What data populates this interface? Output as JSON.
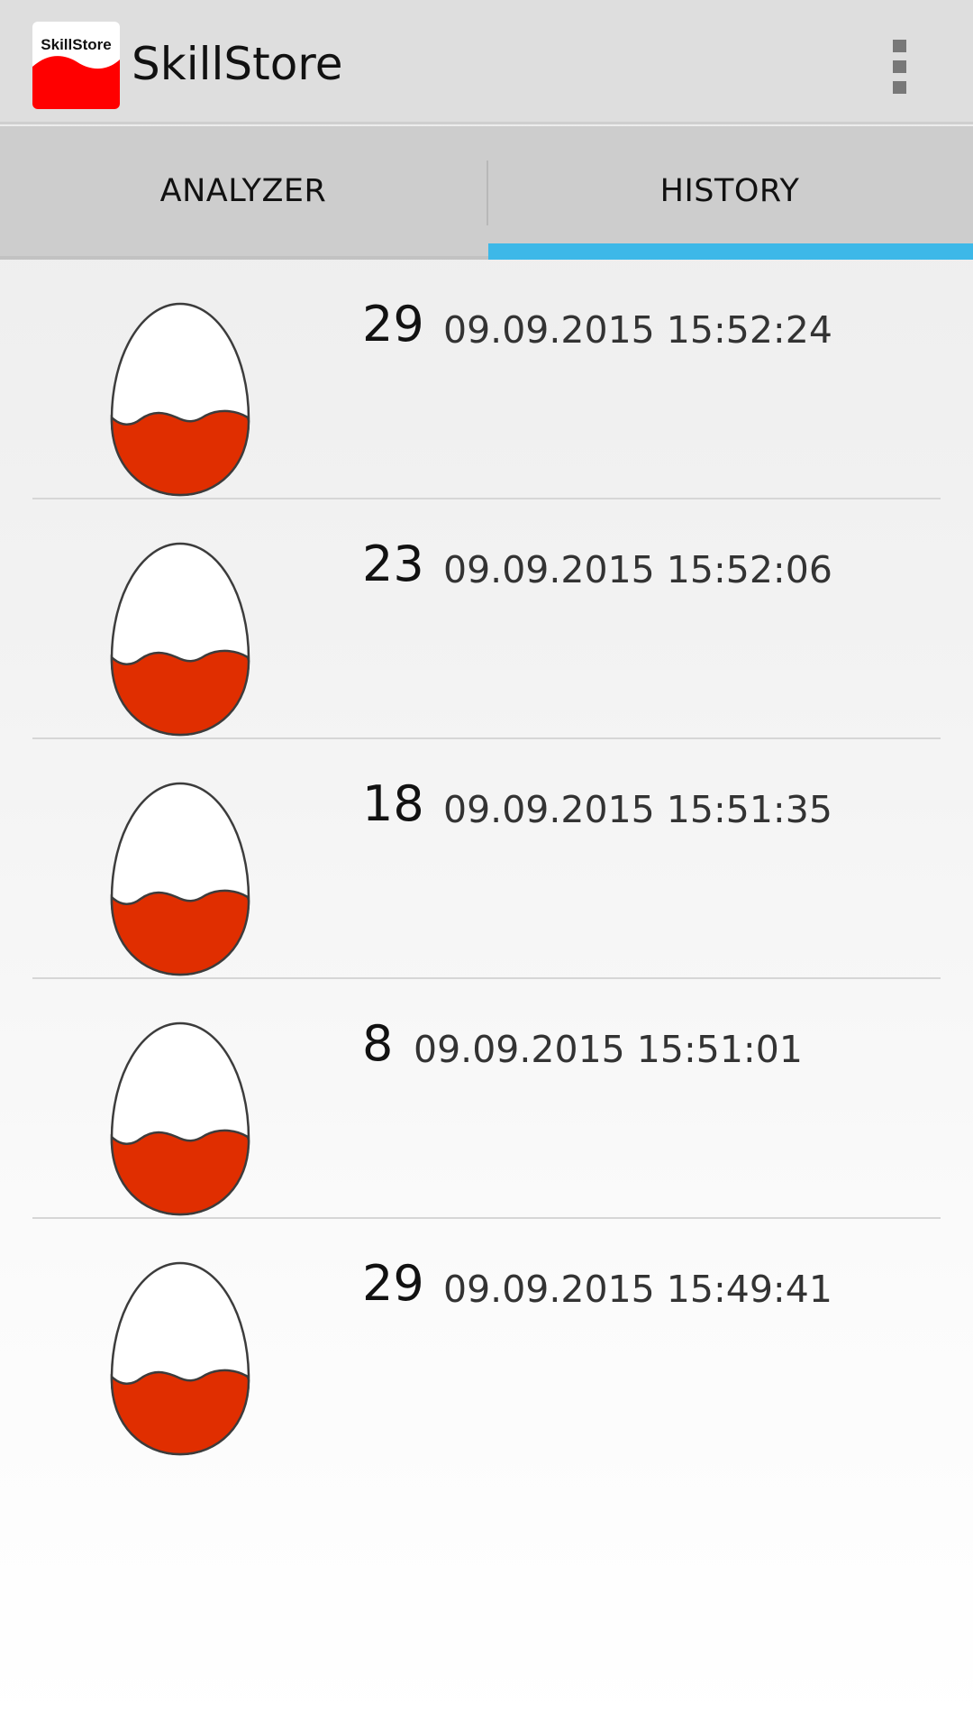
{
  "app": {
    "title": "SkillStore",
    "icon_label": "SkillStore",
    "icon_name": "skillstore-app-icon",
    "menu_icon_name": "overflow-menu-icon"
  },
  "tabs": [
    {
      "label": "ANALYZER",
      "selected": false
    },
    {
      "label": "HISTORY",
      "selected": true
    }
  ],
  "colors": {
    "accent": "#3db8e8",
    "egg_fill": "#e02e00",
    "icon_red": "#ff0000",
    "appbar": "#dedede",
    "tabbar": "#cdcdcd"
  },
  "history": [
    {
      "count": "29",
      "date": "09.09.2015 15:52:24",
      "icon": "egg-icon"
    },
    {
      "count": "23",
      "date": "09.09.2015 15:52:06",
      "icon": "egg-icon"
    },
    {
      "count": "18",
      "date": "09.09.2015 15:51:35",
      "icon": "egg-icon"
    },
    {
      "count": "8",
      "date": "09.09.2015 15:51:01",
      "icon": "egg-icon"
    },
    {
      "count": "29",
      "date": "09.09.2015 15:49:41",
      "icon": "egg-icon"
    }
  ]
}
